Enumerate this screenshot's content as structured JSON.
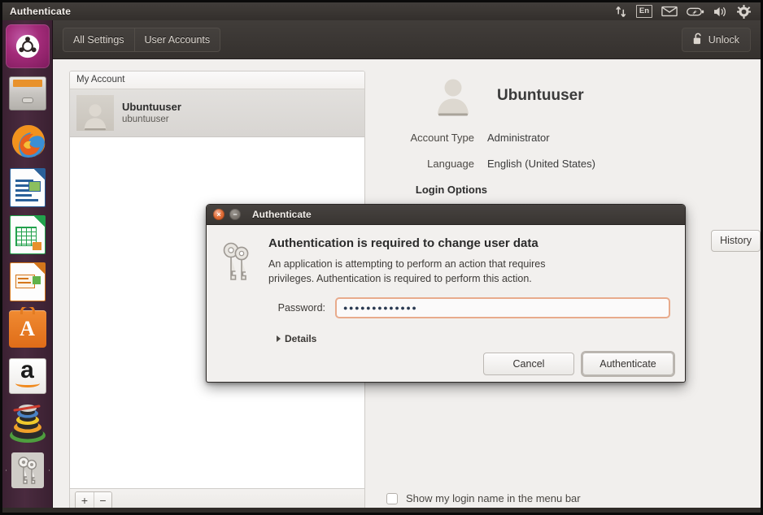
{
  "panel": {
    "title": "Authenticate",
    "indicators": [
      {
        "name": "network-indicator-icon",
        "label": "network"
      },
      {
        "name": "keyboard-layout-indicator",
        "label": "En"
      },
      {
        "name": "messaging-indicator-icon",
        "label": "messages"
      },
      {
        "name": "battery-indicator-icon",
        "label": "battery"
      },
      {
        "name": "volume-indicator-icon",
        "label": "volume"
      },
      {
        "name": "system-menu-icon",
        "label": "system"
      }
    ]
  },
  "launcher": {
    "items": [
      {
        "name": "launcher-dash",
        "label": "Dash Home"
      },
      {
        "name": "launcher-files",
        "label": "Files"
      },
      {
        "name": "launcher-firefox",
        "label": "Firefox Web Browser"
      },
      {
        "name": "launcher-writer",
        "label": "LibreOffice Writer"
      },
      {
        "name": "launcher-calc",
        "label": "LibreOffice Calc"
      },
      {
        "name": "launcher-impress",
        "label": "LibreOffice Impress"
      },
      {
        "name": "launcher-software-center",
        "label": "Ubuntu Software Center"
      },
      {
        "name": "launcher-amazon",
        "label": "Amazon"
      },
      {
        "name": "launcher-system-settings",
        "label": "System Settings"
      },
      {
        "name": "launcher-authenticate",
        "label": "Authenticate"
      }
    ]
  },
  "toolbar": {
    "all_settings_label": "All Settings",
    "user_accounts_label": "User Accounts",
    "unlock_label": "Unlock"
  },
  "user_list": {
    "header": "My Account",
    "rows": [
      {
        "name": "Ubuntuuser",
        "login": "ubuntuuser"
      }
    ],
    "add_label": "+",
    "remove_label": "−"
  },
  "account": {
    "display_name": "Ubuntuuser",
    "fields": [
      {
        "label": "Account Type",
        "value": "Administrator"
      },
      {
        "label": "Language",
        "value": "English (United States)"
      }
    ],
    "login_options_label": "Login Options",
    "history_label": "History",
    "menu_bar_checkbox_label": "Show my login name in the menu bar",
    "menu_bar_checkbox_checked": false
  },
  "dialog": {
    "title": "Authenticate",
    "heading": "Authentication is required to change user data",
    "body_line1": "An application is attempting to perform an action that requires",
    "body_line2": "privileges. Authentication is required to perform this action.",
    "password_label": "Password:",
    "password_value": "●●●●●●●●●●●●●",
    "details_label": "Details",
    "cancel_label": "Cancel",
    "authenticate_label": "Authenticate",
    "close_glyph": "×",
    "minimize_glyph": "−"
  },
  "colors": {
    "panel_bg": "#3a3633",
    "launcher_bg": "#46283c",
    "window_bg": "#f1efed",
    "accent_orange": "#e8ab8c",
    "ubuntu_aubergine": "#772953"
  }
}
